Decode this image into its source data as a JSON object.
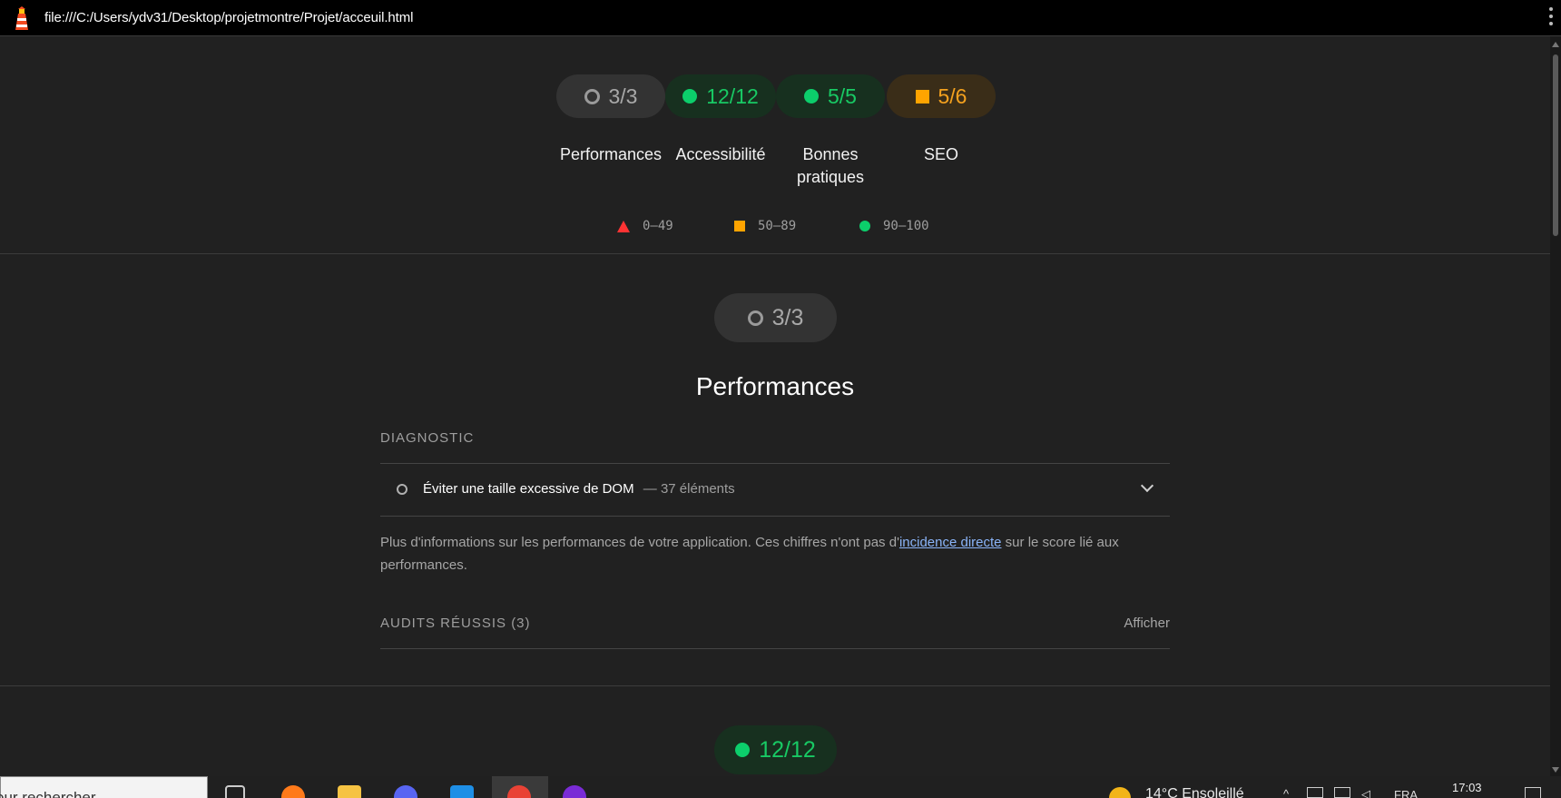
{
  "window": {
    "url": "file:///C:/Users/ydv31/Desktop/projetmontre/Projet/acceuil.html"
  },
  "summary": {
    "gauges": [
      {
        "score": "3/3",
        "label": "Performances",
        "status": "neutral"
      },
      {
        "score": "12/12",
        "label": "Accessibilité",
        "status": "pass"
      },
      {
        "score": "5/5",
        "label": "Bonnes pratiques",
        "status": "pass"
      },
      {
        "score": "5/6",
        "label": "SEO",
        "status": "average"
      }
    ],
    "legend": [
      {
        "range": "0–49",
        "shape": "triangle",
        "color": "#ff3333"
      },
      {
        "range": "50–89",
        "shape": "square",
        "color": "#ffa400"
      },
      {
        "range": "90–100",
        "shape": "circle",
        "color": "#0cce6b"
      }
    ]
  },
  "performance": {
    "score": "3/3",
    "title": "Performances",
    "diagnostic_header": "DIAGNOSTIC",
    "audits": [
      {
        "title": "Éviter une taille excessive de DOM",
        "separator": "—",
        "value": "37 éléments"
      }
    ],
    "description_before": "Plus d'informations sur les performances de votre application. Ces chiffres n'ont pas d'",
    "description_link": "incidence directe",
    "description_after": " sur le score lié aux performances.",
    "passed_header": "AUDITS RÉUSSIS (3)",
    "show_label": "Afficher"
  },
  "next_section": {
    "score": "12/12"
  },
  "taskbar": {
    "search_placeholder": "our rechercher",
    "weather": "14°C  Ensoleillé",
    "language": "FRA",
    "time": "17:03"
  },
  "colors": {
    "pass": "#0cce6b",
    "average": "#ffa400",
    "fail": "#ff3333",
    "link": "#8ab4f8"
  }
}
